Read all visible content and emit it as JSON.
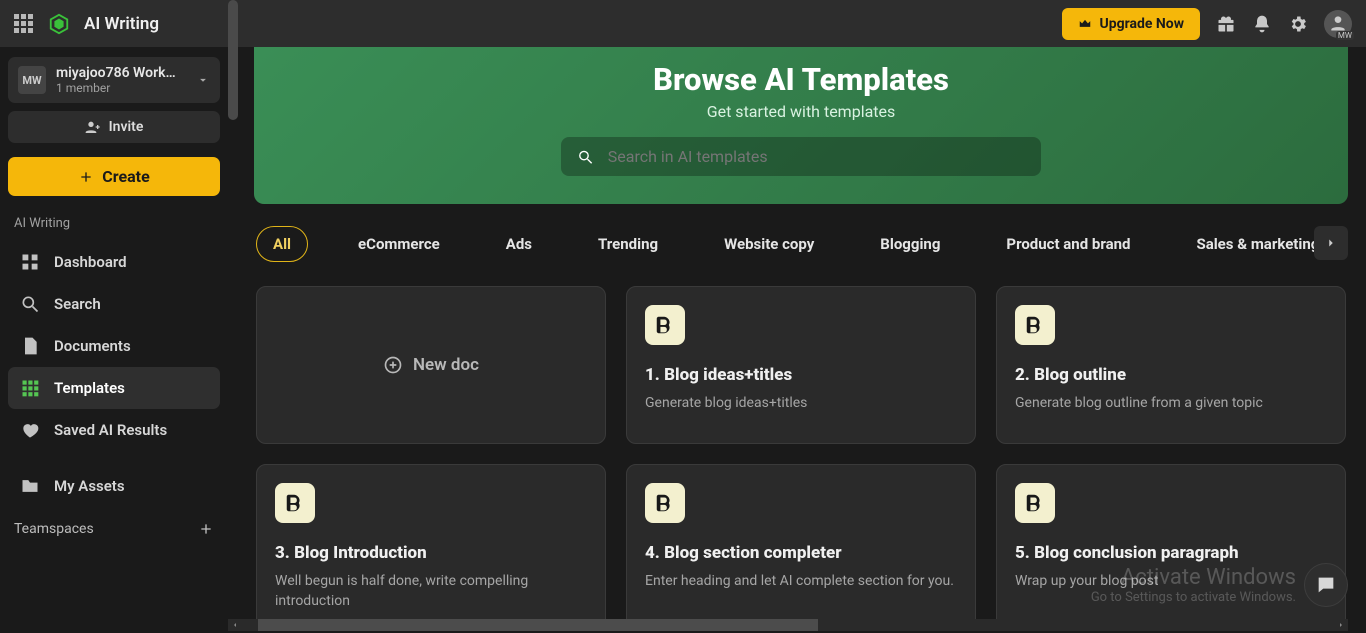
{
  "topbar": {
    "app_title": "AI Writing",
    "upgrade_label": "Upgrade Now",
    "avatar_initials": "MW"
  },
  "workspace": {
    "badge": "MW",
    "name": "miyajoo786 Work…",
    "members": "1 member",
    "invite_label": "Invite"
  },
  "sidebar": {
    "create_label": "Create",
    "section_label": "AI Writing",
    "items": [
      {
        "label": "Dashboard"
      },
      {
        "label": "Search"
      },
      {
        "label": "Documents"
      },
      {
        "label": "Templates"
      },
      {
        "label": "Saved AI Results"
      },
      {
        "label": "My Assets"
      }
    ],
    "teamspaces_label": "Teamspaces"
  },
  "hero": {
    "title": "Browse AI Templates",
    "subtitle": "Get started with templates",
    "search_placeholder": "Search in AI templates"
  },
  "tabs": [
    "All",
    "eCommerce",
    "Ads",
    "Trending",
    "Website copy",
    "Blogging",
    "Product and brand",
    "Sales & marketing"
  ],
  "active_tab": "All",
  "cards": {
    "newdoc_label": "New doc",
    "items": [
      {
        "title": "1. Blog ideas+titles",
        "desc": "Generate blog ideas+titles"
      },
      {
        "title": "2. Blog outline",
        "desc": "Generate blog outline from a given topic"
      },
      {
        "title": "3. Blog Introduction",
        "desc": "Well begun is half done, write compelling introduction"
      },
      {
        "title": "4. Blog section completer",
        "desc": "Enter heading and let AI complete section for you."
      },
      {
        "title": "5. Blog conclusion paragraph",
        "desc": "Wrap up your blog post"
      }
    ]
  },
  "watermark": {
    "line1": "Activate Windows",
    "line2": "Go to Settings to activate Windows."
  }
}
